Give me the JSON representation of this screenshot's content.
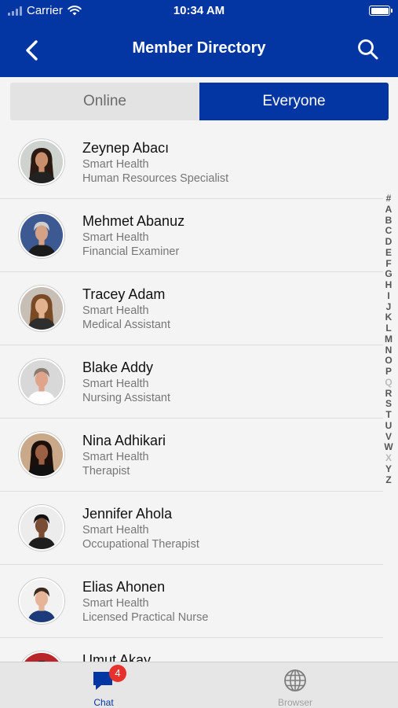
{
  "status_bar": {
    "carrier": "Carrier",
    "time": "10:34 AM"
  },
  "nav": {
    "title": "Member Directory"
  },
  "segments": {
    "online": "Online",
    "everyone": "Everyone",
    "active": "everyone"
  },
  "members": [
    {
      "name": "Zeynep Abacı",
      "company": "Smart Health",
      "role": "Human Resources Specialist"
    },
    {
      "name": "Mehmet Abanuz",
      "company": "Smart Health",
      "role": "Financial Examiner"
    },
    {
      "name": "Tracey Adam",
      "company": "Smart Health",
      "role": "Medical Assistant"
    },
    {
      "name": "Blake Addy",
      "company": "Smart Health",
      "role": "Nursing Assistant"
    },
    {
      "name": "Nina Adhikari",
      "company": "Smart Health",
      "role": "Therapist"
    },
    {
      "name": "Jennifer Ahola",
      "company": "Smart Health",
      "role": "Occupational Therapist"
    },
    {
      "name": "Elias Ahonen",
      "company": "Smart Health",
      "role": "Licensed Practical Nurse"
    },
    {
      "name": "Umut Akay",
      "company": "",
      "role": ""
    }
  ],
  "alpha_index": [
    "#",
    "A",
    "B",
    "C",
    "D",
    "E",
    "F",
    "G",
    "H",
    "I",
    "J",
    "K",
    "L",
    "M",
    "N",
    "O",
    "P",
    "Q",
    "R",
    "S",
    "T",
    "U",
    "V",
    "W",
    "X",
    "Y",
    "Z"
  ],
  "alpha_dim": [
    "Q",
    "X"
  ],
  "tabs": {
    "chat": {
      "label": "Chat",
      "badge": "4",
      "icon": "chat-icon"
    },
    "browser": {
      "label": "Browser",
      "icon": "globe-icon"
    }
  },
  "colors": {
    "brand": "#0436a3",
    "badge": "#e5322d",
    "background": "#f4f4f4"
  }
}
